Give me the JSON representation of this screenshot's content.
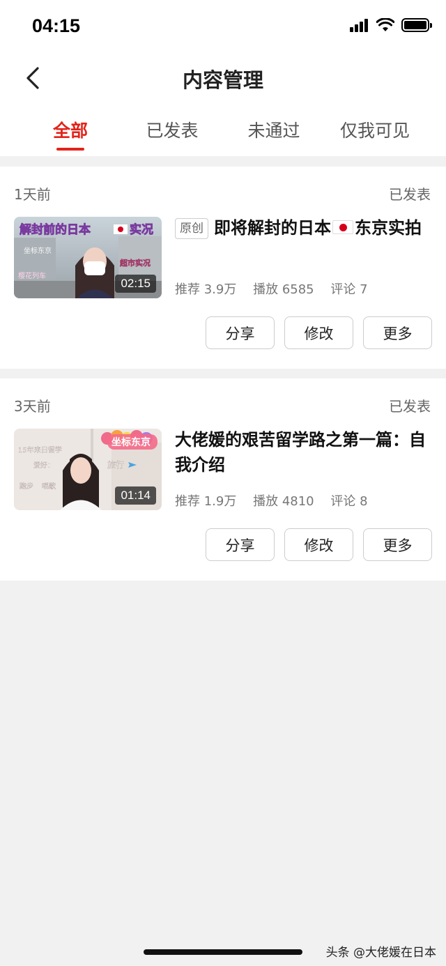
{
  "status_bar": {
    "time": "04:15"
  },
  "header": {
    "title": "内容管理"
  },
  "tabs": [
    {
      "label": "全部",
      "active": true
    },
    {
      "label": "已发表",
      "active": false
    },
    {
      "label": "未通过",
      "active": false
    },
    {
      "label": "仅我可见",
      "active": false
    }
  ],
  "posts": [
    {
      "time": "1天前",
      "status": "已发表",
      "badge": "原创",
      "title_part1": "即将解封的日本",
      "title_part2": "东京实拍",
      "duration": "02:15",
      "thumb_title": "解封前的日本",
      "thumb_title2": "实况",
      "thumb_sub": "超市实况",
      "thumb_side1": "坐标东京",
      "thumb_side2": "樱花列车",
      "stats": {
        "recommend": "推荐 3.9万",
        "plays": "播放 6585",
        "comments": "评论 7"
      },
      "buttons": {
        "share": "分享",
        "edit": "修改",
        "more": "更多"
      }
    },
    {
      "time": "3天前",
      "status": "已发表",
      "title": "大佬媛的艰苦留学路之第一篇：自我介绍",
      "duration": "01:14",
      "thumb_badge": "坐标东京",
      "thumb_left1": "15年来日留学",
      "thumb_left2": "爱好：",
      "thumb_left3": "跑步",
      "thumb_left4": "唱歌",
      "thumb_right": "旅行",
      "stats": {
        "recommend": "推荐 1.9万",
        "plays": "播放 4810",
        "comments": "评论 8"
      },
      "buttons": {
        "share": "分享",
        "edit": "修改",
        "more": "更多"
      }
    }
  ],
  "footer": {
    "watermark": "头条 @大佬媛在日本"
  },
  "colors": {
    "accent": "#e2231a",
    "background": "#f1f1f1",
    "card": "#ffffff"
  }
}
